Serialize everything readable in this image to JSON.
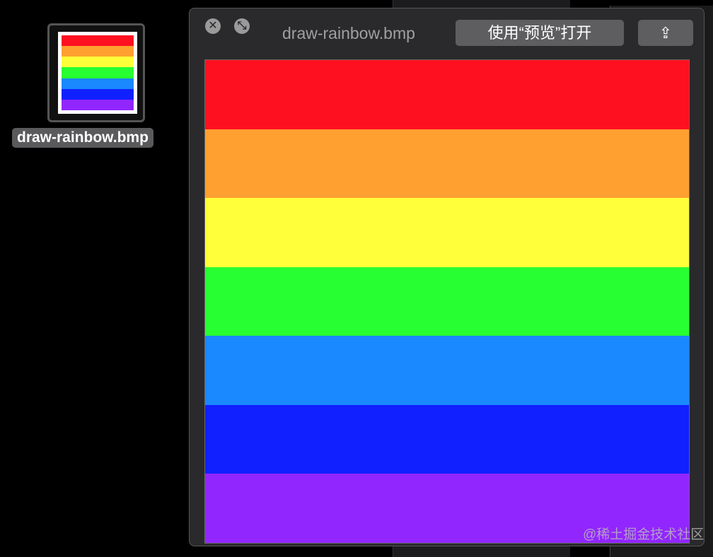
{
  "desktop_file": {
    "name": "draw-rainbow.bmp"
  },
  "quicklook": {
    "title": "draw-rainbow.bmp",
    "open_button": "使用“预览”打开",
    "close_icon": "close-icon",
    "fullscreen_icon": "fullscreen-icon",
    "share_icon": "share-icon"
  },
  "rainbow_colors": [
    "#ff1020",
    "#ffa030",
    "#ffff3a",
    "#28ff32",
    "#1a88ff",
    "#1020ff",
    "#9226ff"
  ],
  "watermark": "@稀土掘金技术社区"
}
